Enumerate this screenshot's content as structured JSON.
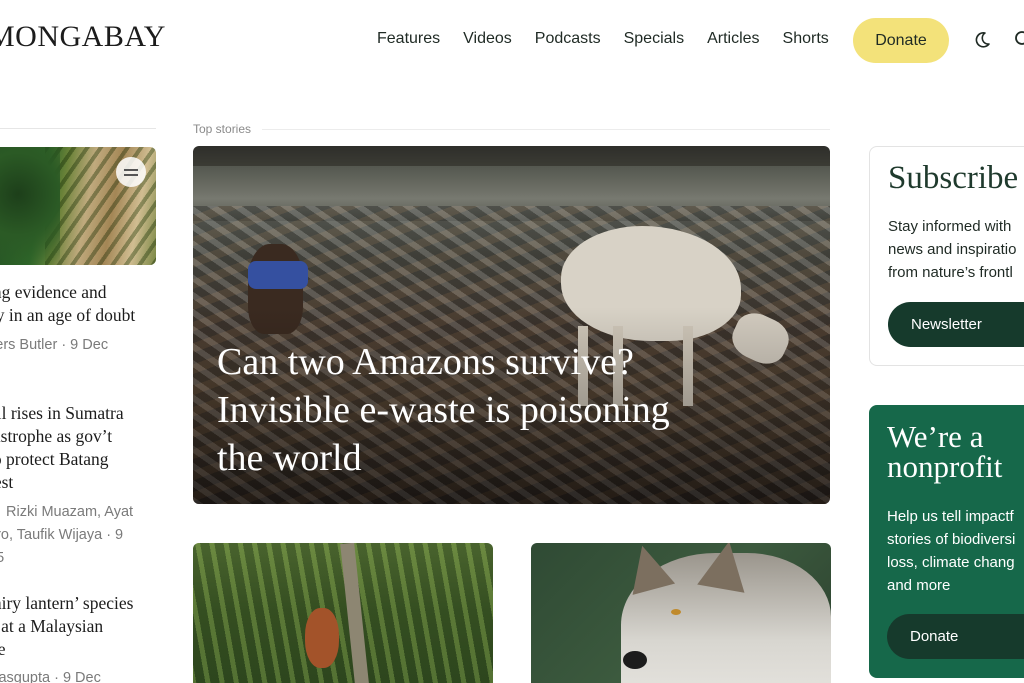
{
  "header": {
    "logo": "MONGABAY",
    "nav": [
      "Features",
      "Videos",
      "Podcasts",
      "Specials",
      "Articles",
      "Shorts"
    ],
    "donate_label": "Donate",
    "icons": [
      "moon-icon",
      "search-icon"
    ]
  },
  "left_column": {
    "stories": [
      {
        "title_lines": [
          "ing evidence and",
          "ay in an age of doubt"
        ],
        "meta_lines": [
          "vers Butler · 9 Dec"
        ]
      },
      {
        "title_lines": [
          "oll rises in Sumatra",
          "tastrophe as gov’t",
          "to protect Batang",
          "rest"
        ],
        "meta_lines": [
          "Rizki Muazam, Ayat",
          "aro, Taufik Wijaya · 9",
          "25"
        ]
      },
      {
        "title_lines": [
          "fairy lantern’ species",
          "d at a Malaysian",
          "ite"
        ],
        "meta_lines": [
          "Dasgupta · 9 Dec"
        ]
      }
    ]
  },
  "main": {
    "section_label": "Top stories",
    "hero_title_lines": [
      "Can two Amazons survive?",
      "Invisible e-waste is poisoning",
      "the world"
    ]
  },
  "sidebar": {
    "subscribe": {
      "title": "Subscribe",
      "text_lines": [
        "Stay informed with",
        "news and inspiratio",
        "from nature’s frontl"
      ],
      "button_label": "Newsletter"
    },
    "nonprofit": {
      "title_lines": [
        "We’re a",
        "nonprofit"
      ],
      "text_lines": [
        "Help us tell impactf",
        "stories of biodiversi",
        "loss, climate chang",
        "and more"
      ],
      "button_label": "Donate"
    }
  },
  "colors": {
    "donate_yellow": "#f3e27a",
    "dark_green": "#163a2c",
    "nonprofit_green": "#16684a"
  }
}
